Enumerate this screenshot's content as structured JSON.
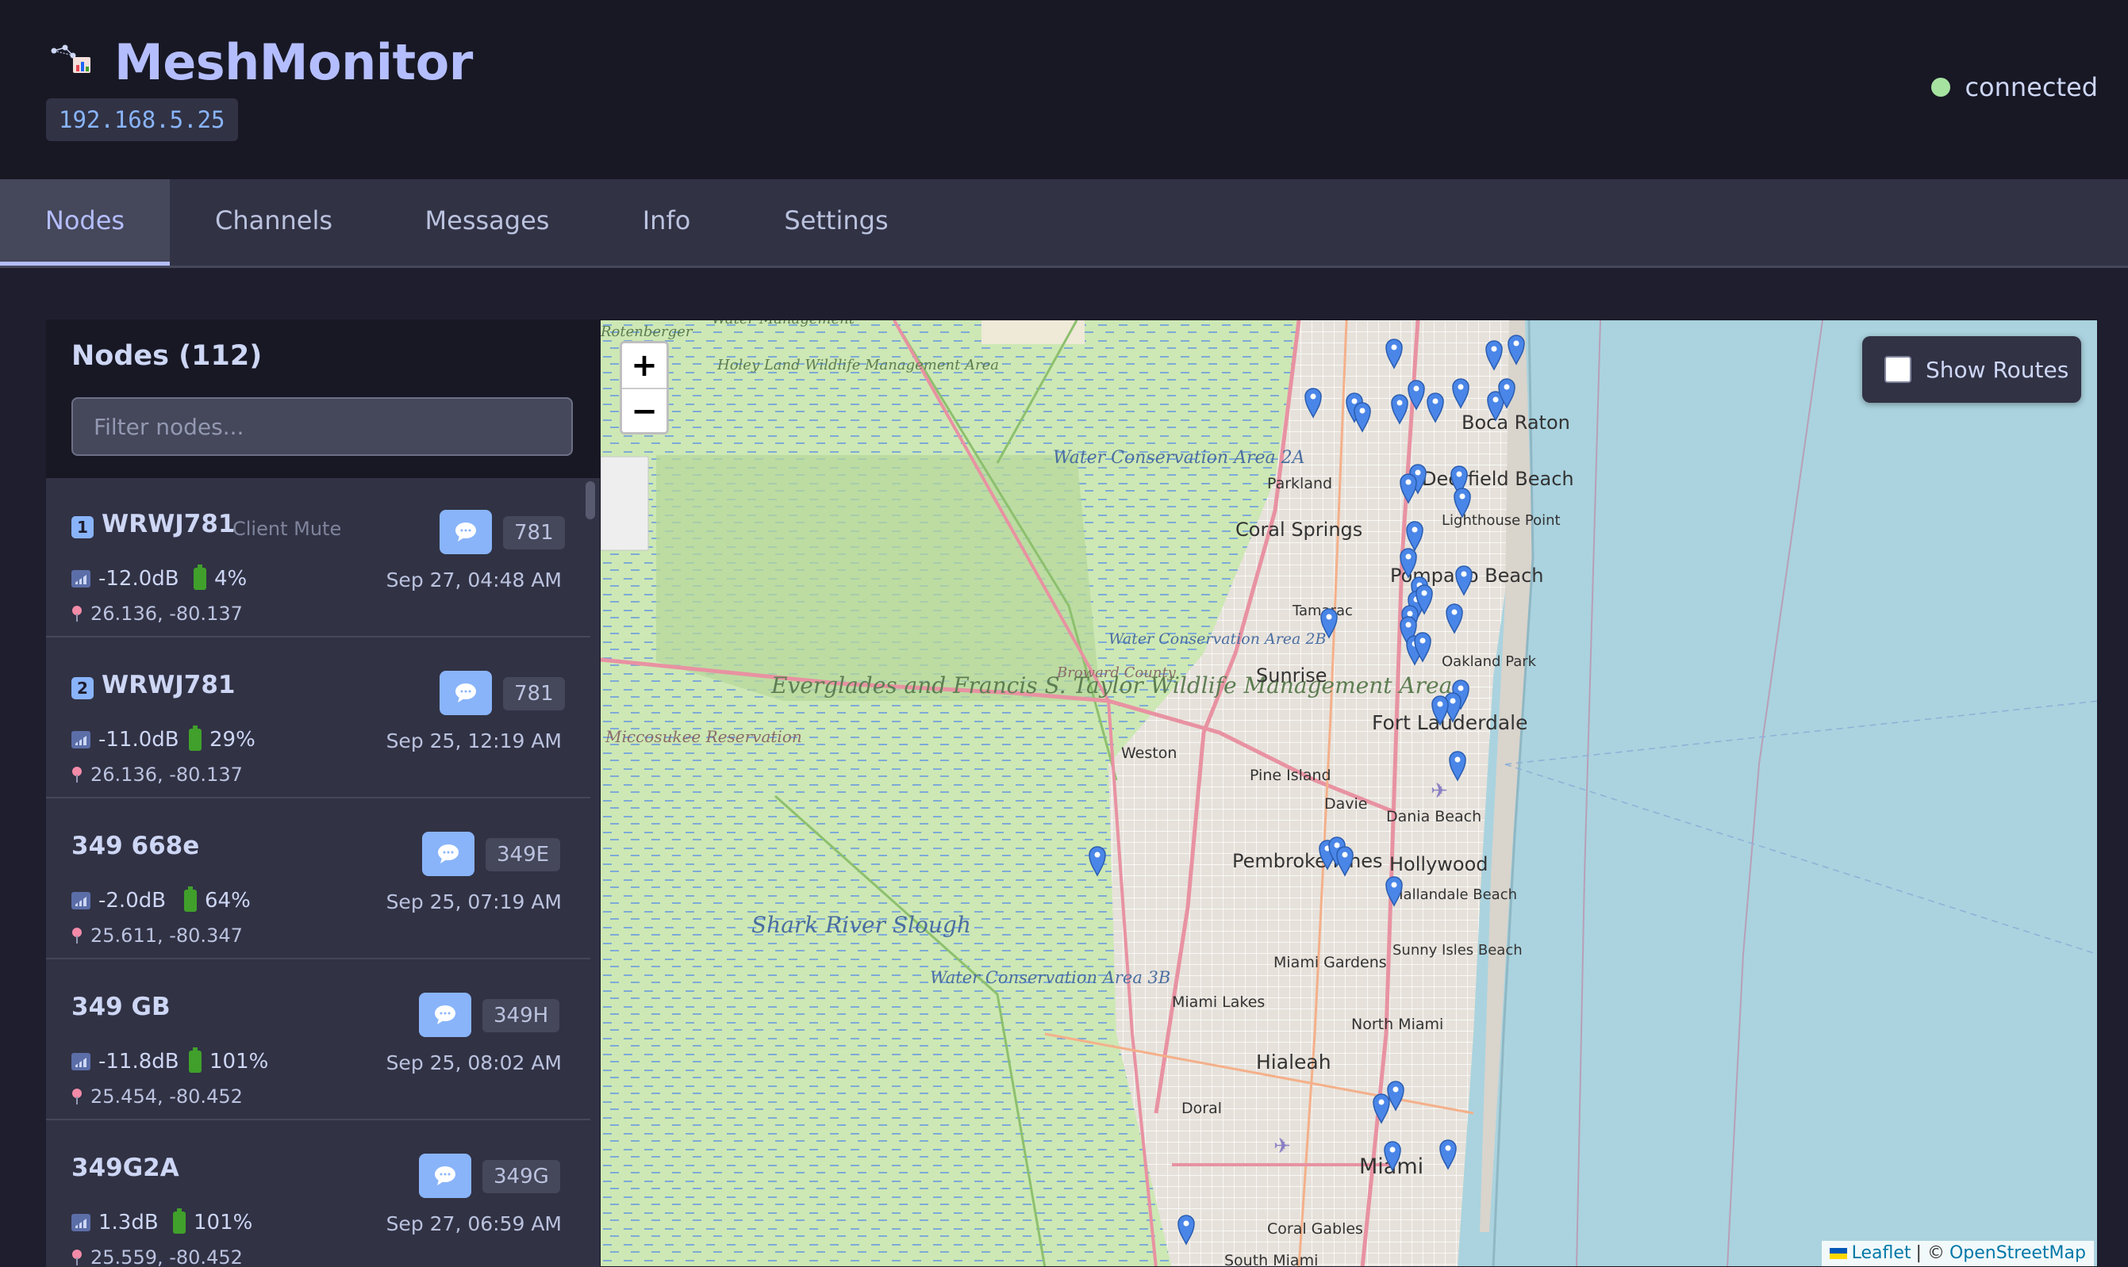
{
  "header": {
    "app_title": "MeshMonitor",
    "ip_address": "192.168.5.25",
    "status": "connected"
  },
  "tabs": [
    {
      "label": "Nodes",
      "active": true
    },
    {
      "label": "Channels",
      "active": false
    },
    {
      "label": "Messages",
      "active": false
    },
    {
      "label": "Info",
      "active": false
    },
    {
      "label": "Settings",
      "active": false
    }
  ],
  "sidebar": {
    "title": "Nodes (112)",
    "filter_placeholder": "Filter nodes...",
    "nodes": [
      {
        "rank": "1",
        "name": "WRWJ781",
        "role": "Client Mute",
        "short": "781",
        "snr": "-12.0dB",
        "battery": "4%",
        "last_heard": "Sep 27, 04:48 AM",
        "coords": "26.136, -80.137"
      },
      {
        "rank": "2",
        "name": "WRWJ781",
        "role": "",
        "short": "781",
        "snr": "-11.0dB",
        "battery": "29%",
        "last_heard": "Sep 25, 12:19 AM",
        "coords": "26.136, -80.137"
      },
      {
        "rank": "",
        "name": "349 668e",
        "role": "",
        "short": "349E",
        "snr": "-2.0dB",
        "battery": "64%",
        "last_heard": "Sep 25, 07:19 AM",
        "coords": "25.611, -80.347"
      },
      {
        "rank": "",
        "name": "349 GB",
        "role": "",
        "short": "349H",
        "snr": "-11.8dB",
        "battery": "101%",
        "last_heard": "Sep 25, 08:02 AM",
        "coords": "25.454, -80.452"
      },
      {
        "rank": "",
        "name": "349G2A",
        "role": "",
        "short": "349G",
        "snr": "1.3dB",
        "battery": "101%",
        "last_heard": "Sep 27, 06:59 AM",
        "coords": "25.559, -80.452"
      }
    ]
  },
  "map": {
    "zoom_in": "+",
    "zoom_out": "−",
    "routes_label": "Show Routes",
    "routes_enabled": false,
    "attribution_leaflet": "Leaflet",
    "attribution_sep": "| ©",
    "attribution_osm": "OpenStreetMap",
    "colors": {
      "water": "#aad3df",
      "wetland": "#d4ecb7",
      "urban": "#e8e2da",
      "motorway": "#e892a2",
      "pin": "#4a86e8"
    },
    "labels": [
      "Boca Raton",
      "Deerfield Beach",
      "Lighthouse Point",
      "Parkland",
      "Coral Springs",
      "Tamarac",
      "Pompano Beach",
      "Oakland Park",
      "Sunrise",
      "Fort Lauderdale",
      "Water Conservation Area 2A",
      "Water Conservation Area 2B",
      "Broward County",
      "Everglades and Francis S. Taylor Wildlife Management Area",
      "Weston",
      "Pine Island",
      "Davie",
      "Dania Beach",
      "Pembroke Pines",
      "Hollywood",
      "Hallandale Beach",
      "Sunny Isles Beach",
      "Miami Gardens",
      "Miami Lakes",
      "North Miami",
      "Hialeah",
      "Doral",
      "Miami",
      "Coral Gables",
      "South Miami",
      "Shark River Slough",
      "Water Conservation Area 3B",
      "Miccosukee Reservation",
      "Holey Land Wildlife Management Area",
      "Water Management",
      "Rotenberger"
    ]
  }
}
